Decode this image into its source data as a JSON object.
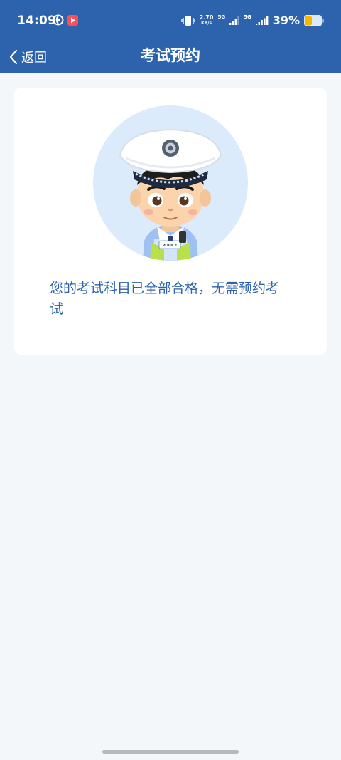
{
  "status_bar": {
    "time": "14:09",
    "speed_value": "2.70",
    "speed_unit": "KB/s",
    "network_label_1": "5G",
    "network_label_2": "5G",
    "battery_percent": "39%"
  },
  "nav": {
    "back_label": "返回",
    "title": "考试预约"
  },
  "card": {
    "message": "您的考试科目已全部合格，无需预约考试",
    "badge_text": "POLICE"
  },
  "colors": {
    "primary": "#2d63ad",
    "avatar_bg": "#dcebfb",
    "page_bg": "#f4f7fa",
    "battery_fill": "#f5b800"
  }
}
